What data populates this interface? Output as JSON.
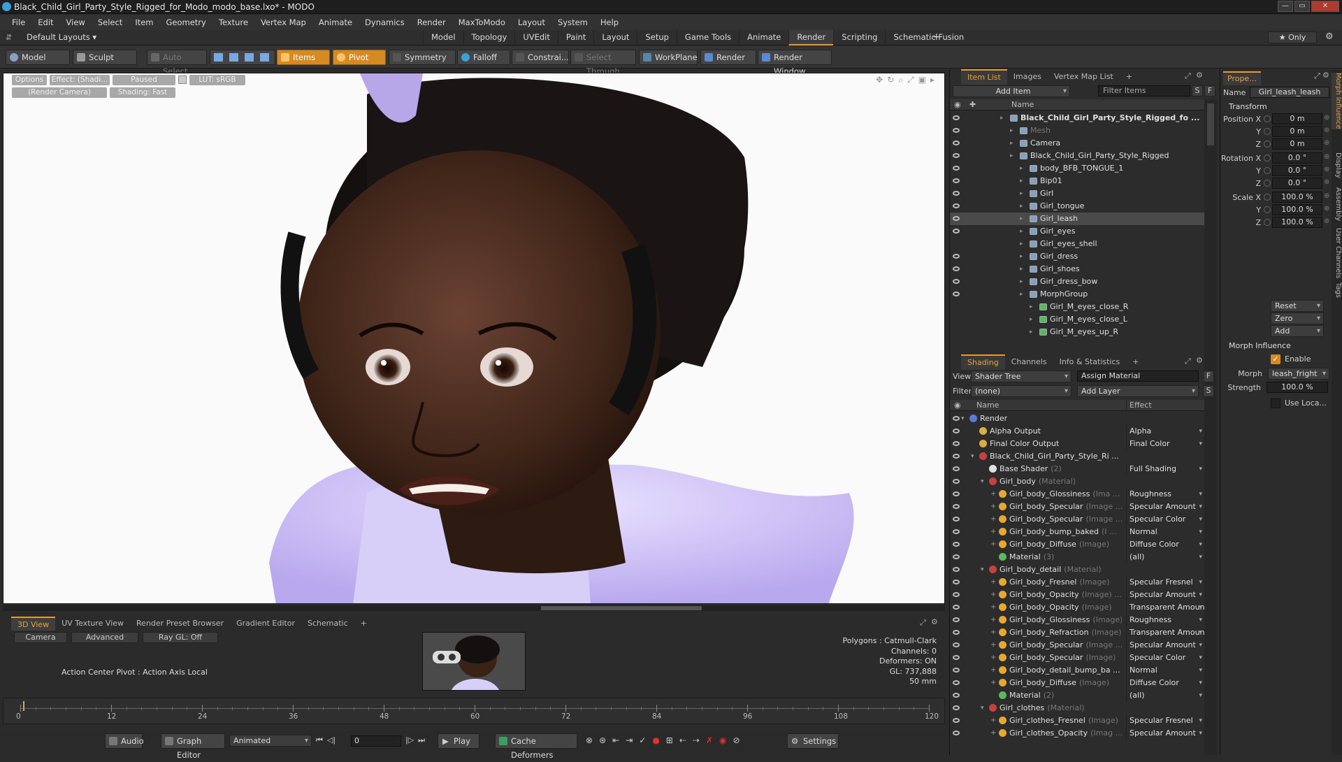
{
  "window": {
    "title": "Black_Child_Girl_Party_Style_Rigged_for_Modo_modo_base.lxo* - MODO",
    "controls": [
      "—",
      "▭",
      "✕"
    ]
  },
  "menu": [
    "File",
    "Edit",
    "View",
    "Select",
    "Item",
    "Geometry",
    "Texture",
    "Vertex Map",
    "Animate",
    "Dynamics",
    "Render",
    "MaxToModo",
    "Layout",
    "System",
    "Help"
  ],
  "layout": {
    "preset": "Default Layouts ▾",
    "tabs": [
      "Model",
      "Topology",
      "UVEdit",
      "Paint",
      "Layout",
      "Setup",
      "Game Tools",
      "Animate",
      "Render",
      "Scripting",
      "Schematic Fusion"
    ],
    "active_tab": "Render",
    "add": "+",
    "only": "★ Only"
  },
  "toolbar": {
    "model": "Model",
    "sculpt": "Sculpt",
    "auto_select": "Auto Select",
    "items": "Items",
    "pivot": "Pivot",
    "symmetry": "Symmetry",
    "falloff": "Falloff",
    "constrain": "Constrai...",
    "select_through": "Select Through",
    "workplane": "WorkPlane",
    "render": "Render",
    "render_window": "Render Window"
  },
  "viewport": {
    "options": "Options",
    "effect": "Effect: (Shadi...",
    "paused": "Paused",
    "lut": "LUT: sRGB",
    "camera": "(Render Camera)",
    "shading": "Shading: Fast"
  },
  "bottom": {
    "tabs": [
      "3D View",
      "UV Texture View",
      "Render Preset Browser",
      "Gradient Editor",
      "Schematic",
      "+"
    ],
    "active_tab": "3D View",
    "camera": "Camera",
    "advanced": "Advanced",
    "raygl": "Ray GL: Off",
    "action_center": "Action Center Pivot : Action Axis Local",
    "stats": [
      "Polygons : Catmull-Clark",
      "Channels: 0",
      "Deformers: ON",
      "GL: 737,888",
      "50 mm"
    ]
  },
  "timeline": {
    "ticks": [
      "0",
      "12",
      "24",
      "36",
      "48",
      "60",
      "72",
      "84",
      "96",
      "108",
      "120"
    ],
    "lower": [
      "0",
      "120",
      "120"
    ]
  },
  "transport": {
    "audio": "Audio",
    "graph_editor": "Graph Editor",
    "animated": "Animated",
    "frame": "0",
    "play": "Play",
    "cache_deformers": "Cache Deformers",
    "settings": "Settings"
  },
  "itemlist": {
    "tabs": [
      "Item List",
      "Images",
      "Vertex Map List",
      "+"
    ],
    "active_tab": "Item List",
    "add_item": "Add Item",
    "filter": "Filter Items",
    "s": "S",
    "f": "F",
    "col_name": "Name",
    "items": [
      {
        "name": "Black_Child_Girl_Party_Style_Rigged_fo ...",
        "indent": 0,
        "bold": true,
        "eye": true
      },
      {
        "name": "Mesh",
        "indent": 1,
        "dim": true,
        "eye": true
      },
      {
        "name": "Camera",
        "indent": 1,
        "eye": true
      },
      {
        "name": "Black_Child_Girl_Party_Style_Rigged",
        "indent": 1,
        "eye": true
      },
      {
        "name": "body_BFB_TONGUE_1",
        "indent": 2,
        "eye": true
      },
      {
        "name": "Bip01",
        "indent": 2,
        "eye": true
      },
      {
        "name": "Girl",
        "indent": 2,
        "eye": true
      },
      {
        "name": "Girl_tongue",
        "indent": 2,
        "eye": true
      },
      {
        "name": "Girl_leash",
        "indent": 2,
        "eye": true,
        "selected": true
      },
      {
        "name": "Girl_eyes",
        "indent": 2,
        "eye": true
      },
      {
        "name": "Girl_eyes_shell",
        "indent": 2,
        "eye": false
      },
      {
        "name": "Girl_dress",
        "indent": 2,
        "eye": true
      },
      {
        "name": "Girl_shoes",
        "indent": 2,
        "eye": true
      },
      {
        "name": "Girl_dress_bow",
        "indent": 2,
        "eye": true
      },
      {
        "name": "MorphGroup",
        "indent": 2,
        "eye": true
      },
      {
        "name": "Girl_M_eyes_close_R",
        "indent": 3,
        "eye": false
      },
      {
        "name": "Girl_M_eyes_close_L",
        "indent": 3,
        "eye": false
      },
      {
        "name": "Girl_M_eyes_up_R",
        "indent": 3,
        "eye": false
      }
    ]
  },
  "shading": {
    "tabs": [
      "Shading",
      "Channels",
      "Info & Statistics",
      "+"
    ],
    "active_tab": "Shading",
    "view_label": "View",
    "view": "Shader Tree",
    "assign": "Assign Material",
    "filter_label": "Filter",
    "filter": "(none)",
    "add_layer": "Add Layer",
    "col_name": "Name",
    "col_effect": "Effect",
    "rows": [
      {
        "name": "Render",
        "sub": "",
        "effect": "",
        "indent": 0,
        "icon": "render"
      },
      {
        "name": "Alpha Output",
        "sub": "",
        "effect": "Alpha",
        "indent": 1,
        "icon": "output"
      },
      {
        "name": "Final Color Output",
        "sub": "",
        "effect": "Final Color",
        "indent": 1,
        "icon": "output"
      },
      {
        "name": "Black_Child_Girl_Party_Style_Ri ...",
        "sub": "",
        "effect": "",
        "indent": 1,
        "icon": "group"
      },
      {
        "name": "Base Shader",
        "sub": "(2)",
        "effect": "Full Shading",
        "indent": 2,
        "icon": "shader"
      },
      {
        "name": "Girl_body",
        "sub": "(Material)",
        "effect": "",
        "indent": 2,
        "icon": "mask"
      },
      {
        "name": "Girl_body_Glossiness",
        "sub": "(Ima ...",
        "effect": "Roughness",
        "indent": 3,
        "icon": "image"
      },
      {
        "name": "Girl_body_Specular",
        "sub": "(Image ...",
        "effect": "Specular Amount",
        "indent": 3,
        "icon": "image"
      },
      {
        "name": "Girl_body_Specular",
        "sub": "(Image ...",
        "effect": "Specular Color",
        "indent": 3,
        "icon": "image"
      },
      {
        "name": "Girl_body_bump_baked",
        "sub": "(I ...",
        "effect": "Normal",
        "indent": 3,
        "icon": "image"
      },
      {
        "name": "Girl_body_Diffuse",
        "sub": "(Image)",
        "effect": "Diffuse Color",
        "indent": 3,
        "icon": "image"
      },
      {
        "name": "Material",
        "sub": "(3)",
        "effect": "(all)",
        "indent": 3,
        "icon": "material"
      },
      {
        "name": "Girl_body_detail",
        "sub": "(Material)",
        "effect": "",
        "indent": 2,
        "icon": "mask"
      },
      {
        "name": "Girl_body_Fresnel",
        "sub": "(Image)",
        "effect": "Specular Fresnel",
        "indent": 3,
        "icon": "image"
      },
      {
        "name": "Girl_body_Opacity",
        "sub": "(Image) ...",
        "effect": "Specular Amount",
        "indent": 3,
        "icon": "image"
      },
      {
        "name": "Girl_body_Opacity",
        "sub": "(Image)",
        "effect": "Transparent Amount",
        "indent": 3,
        "icon": "image"
      },
      {
        "name": "Girl_body_Glossiness",
        "sub": "(Image)",
        "effect": "Roughness",
        "indent": 3,
        "icon": "image"
      },
      {
        "name": "Girl_body_Refraction",
        "sub": "(Image)",
        "effect": "Transparent Amount",
        "indent": 3,
        "icon": "image"
      },
      {
        "name": "Girl_body_Specular",
        "sub": "(Image ...",
        "effect": "Specular Amount",
        "indent": 3,
        "icon": "image"
      },
      {
        "name": "Girl_body_Specular",
        "sub": "(Image)",
        "effect": "Specular Color",
        "indent": 3,
        "icon": "image"
      },
      {
        "name": "Girl_body_detail_bump_ba ...",
        "sub": "",
        "effect": "Normal",
        "indent": 3,
        "icon": "image"
      },
      {
        "name": "Girl_body_Diffuse",
        "sub": "(Image)",
        "effect": "Diffuse Color",
        "indent": 3,
        "icon": "image"
      },
      {
        "name": "Material",
        "sub": "(2)",
        "effect": "(all)",
        "indent": 3,
        "icon": "material"
      },
      {
        "name": "Girl_clothes",
        "sub": "(Material)",
        "effect": "",
        "indent": 2,
        "icon": "mask"
      },
      {
        "name": "Girl_clothes_Fresnel",
        "sub": "(Image)",
        "effect": "Specular Fresnel",
        "indent": 3,
        "icon": "image"
      },
      {
        "name": "Girl_clothes_Opacity",
        "sub": "(Imag ...",
        "effect": "Specular Amount",
        "indent": 3,
        "icon": "image"
      }
    ]
  },
  "properties": {
    "tab": "Prope...",
    "name_label": "Name",
    "name": "Girl_leash_leash",
    "transform": "Transform",
    "fields": [
      {
        "label": "Position X",
        "value": "0 m"
      },
      {
        "label": "Y",
        "value": "0 m"
      },
      {
        "label": "Z",
        "value": "0 m"
      },
      {
        "label": "Rotation X",
        "value": "0.0 °"
      },
      {
        "label": "Y",
        "value": "0.0 °"
      },
      {
        "label": "Z",
        "value": "0.0 °"
      },
      {
        "label": "Scale X",
        "value": "100.0 %"
      },
      {
        "label": "Y",
        "value": "100.0 %"
      },
      {
        "label": "Z",
        "value": "100.0 %"
      }
    ],
    "reset": "Reset",
    "zero": "Zero",
    "add": "Add",
    "morph_influence": "Morph Influence",
    "enable": "Enable",
    "morph_label": "Morph",
    "morph": "leash_fright",
    "strength_label": "Strength",
    "strength": "100.0 %",
    "use_local": "Use Loca..."
  },
  "side_tabs": [
    "Morph Influence",
    "Display",
    "Assembly",
    "User Channels",
    "Tags"
  ],
  "colors": {
    "accent": "#e89a2c",
    "panel": "#2c2c2c",
    "viewport_bg": "#fafafa"
  }
}
